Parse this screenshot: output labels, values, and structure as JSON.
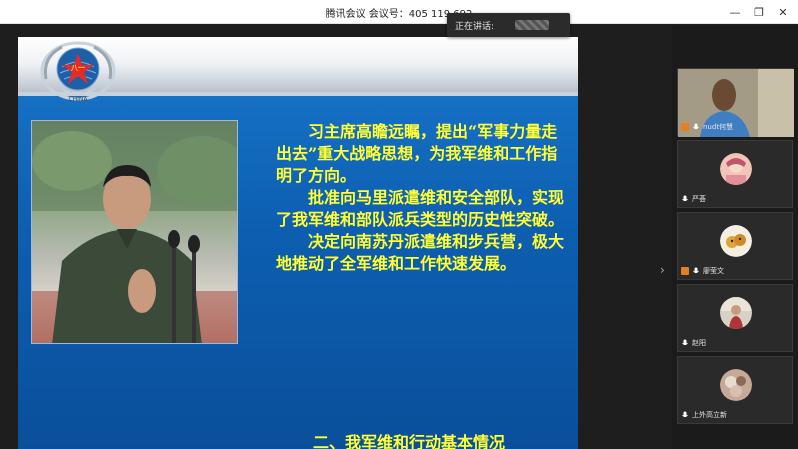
{
  "window": {
    "title": "腾讯会议 会议号：405 119 692"
  },
  "speaking": {
    "label": "正在讲话:"
  },
  "slide": {
    "paragraphs": [
      "习主席高瞻远瞩，提出“军事力量走出去”重大战略思想，为我军维和工作指明了方向。",
      "批准向马里派遣维和安全部队，实现了我军维和部队派兵类型的历史性突破。",
      "决定向南苏丹派遣维和步兵营，极大地推动了全军维和工作快速发展。"
    ],
    "section_title": "二、我军维和行动基本情况",
    "emblem_text": "CHINA"
  },
  "participants": [
    {
      "name": "nudt何慧",
      "type": "video"
    },
    {
      "name": "严荟",
      "type": "avatar",
      "avatar_color": "#f2c6b6"
    },
    {
      "name": "廖莹文",
      "type": "avatar",
      "avatar_color": "#f5efe2"
    },
    {
      "name": "赵阳",
      "type": "avatar",
      "avatar_color": "#d8d2c6"
    },
    {
      "name": "上外高立新",
      "type": "avatar",
      "avatar_color": "#c7a998"
    }
  ],
  "colors": {
    "accent_text": "#ffff33",
    "slide_blue": "#0d5fb2"
  }
}
